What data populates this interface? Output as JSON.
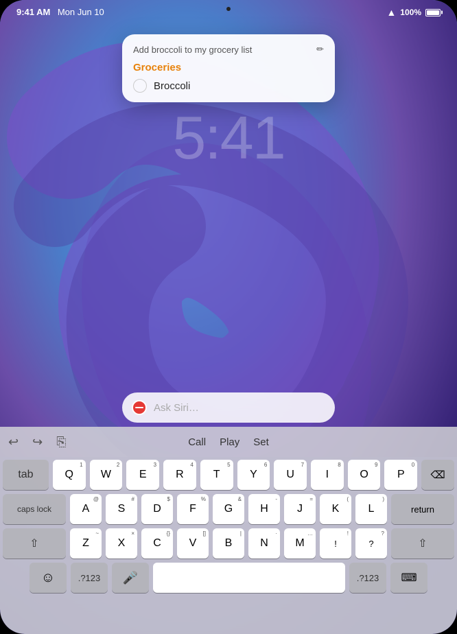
{
  "device": {
    "top_dot": true
  },
  "status_bar": {
    "time": "9:41 AM",
    "date": "Mon Jun 10",
    "wifi_label": "WiFi",
    "battery_pct": "100%"
  },
  "notification": {
    "header": "Add broccoli to my grocery list",
    "edit_icon": "✏",
    "list_name": "Groceries",
    "item_name": "Broccoli",
    "checked": false
  },
  "lock_time": "5:41",
  "siri": {
    "placeholder": "Ask Siri…"
  },
  "suggestion_bar": {
    "undo_icon": "↩",
    "redo_icon": "↪",
    "copy_icon": "⎘",
    "words": [
      "Call",
      "Play",
      "Set"
    ]
  },
  "keyboard": {
    "rows": [
      [
        "Q",
        "W",
        "E",
        "R",
        "T",
        "Y",
        "U",
        "I",
        "O",
        "P"
      ],
      [
        "A",
        "S",
        "D",
        "F",
        "G",
        "H",
        "J",
        "K",
        "L"
      ],
      [
        "Z",
        "X",
        "C",
        "V",
        "B",
        "N",
        "M"
      ]
    ],
    "row1_subs": [
      "1",
      "2",
      "3",
      "4",
      "5",
      "6",
      "7",
      "8",
      "9",
      "0"
    ],
    "row2_subs": [
      "@",
      "#",
      "$",
      "%",
      "&",
      "-",
      "=",
      "(",
      ")"
    ],
    "row3_subs": [
      "~",
      "×",
      "{}",
      "[]",
      "|",
      "·",
      "…",
      "!",
      "?"
    ],
    "special": {
      "tab": "tab",
      "caps_lock": "caps lock",
      "shift": "shift",
      "delete": "delete",
      "return": "return",
      "emoji": "☺",
      "num_toggle": ".?123",
      "space": "",
      "num_toggle_right": ".?123",
      "keyboard_icon": "⌨"
    }
  }
}
